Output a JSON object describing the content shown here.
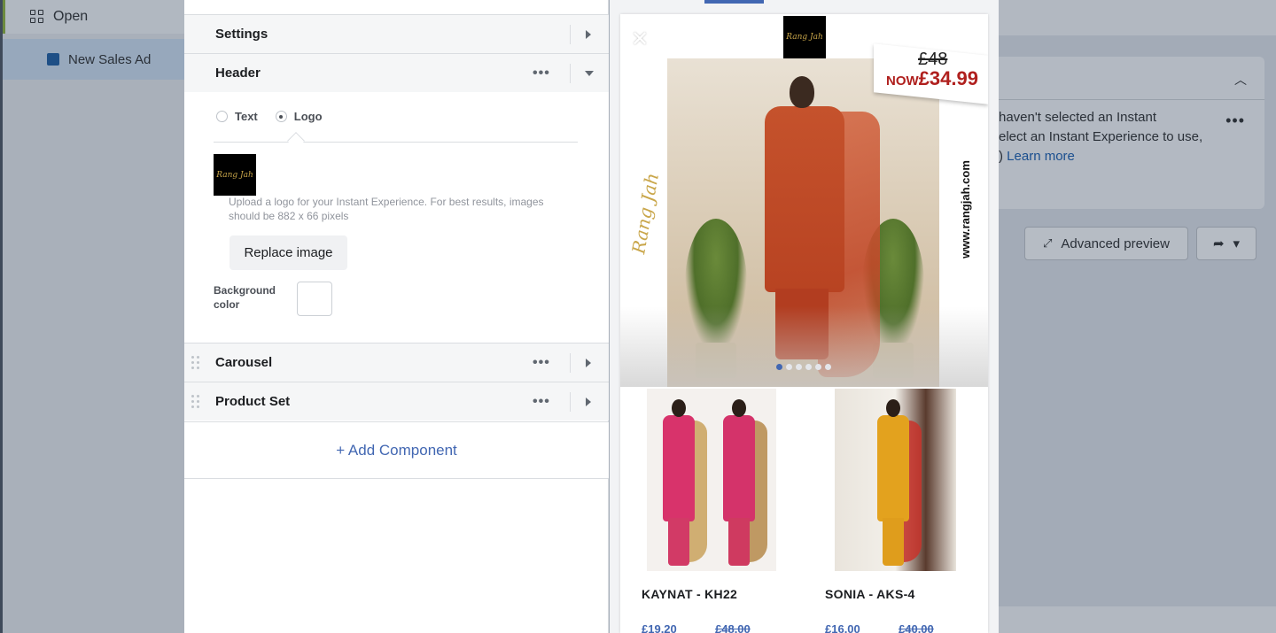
{
  "background": {
    "left_nav": {
      "open_label": "Open",
      "ad_label": "New Sales Ad"
    },
    "right_panel": {
      "message_lines": [
        "haven't selected an Instant",
        "elect an Instant Experience to use,",
        ")"
      ],
      "learn_more": "Learn more",
      "advanced_preview": "Advanced preview"
    }
  },
  "editor": {
    "sections": {
      "settings": "Settings",
      "header": "Header",
      "carousel": "Carousel",
      "product_set": "Product Set"
    },
    "header_options": {
      "text_label": "Text",
      "logo_label": "Logo",
      "selected": "Logo"
    },
    "upload_note": "Upload a logo for your Instant Experience. For best results, images should be 882 x 66 pixels",
    "replace_image": "Replace image",
    "background_color_label": "Background color",
    "background_color_value": "#ffffff",
    "add_component": "+ Add Component"
  },
  "preview": {
    "brand_name": "Rang Jah",
    "website": "www.rangjah.com",
    "price_was": "£48",
    "price_now_prefix": "NOW",
    "price_now": "£34.99",
    "carousel_dots": 6,
    "carousel_active_dot": 0,
    "products": [
      {
        "name": "KAYNAT - KH22",
        "sale_price": "£19.20",
        "original_price": "£48.00"
      },
      {
        "name": "SONIA - AKS-4",
        "sale_price": "£16.00",
        "original_price": "£40.00"
      }
    ]
  },
  "colors": {
    "accent": "#4267b2",
    "price_red": "#b0201e",
    "brand_gold": "#c9a64a"
  }
}
